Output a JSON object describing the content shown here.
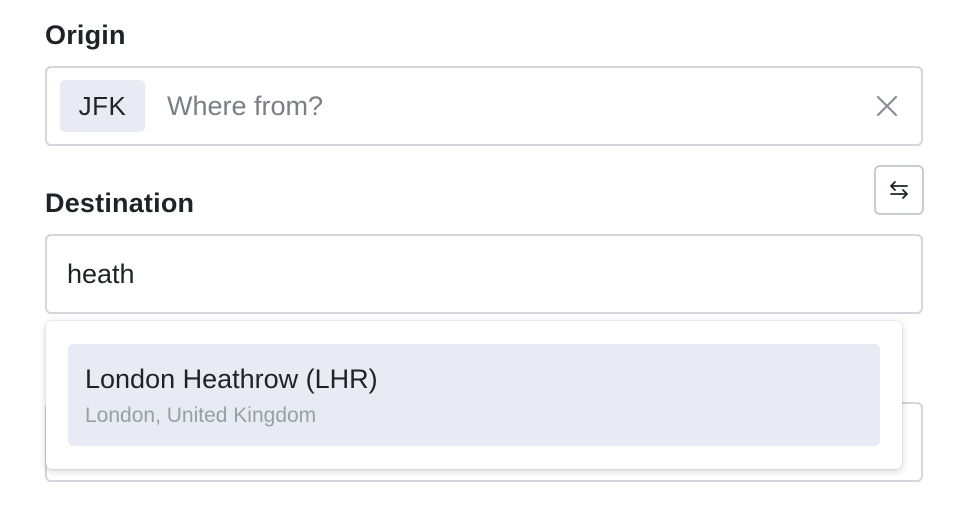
{
  "origin": {
    "label": "Origin",
    "selected_code": "JFK",
    "value": "",
    "placeholder": "Where from?",
    "clear_icon": "close-icon"
  },
  "swap": {
    "icon": "swap-arrows-icon"
  },
  "destination": {
    "label": "Destination",
    "value": "heath"
  },
  "suggestions": [
    {
      "name": "London Heathrow (LHR)",
      "location": "London, United Kingdom"
    }
  ],
  "colors": {
    "chip_bg": "#e8ebf3",
    "highlight_bg": "#e8ebf3",
    "border": "#d3d6db",
    "text": "#1f2328",
    "muted": "#9a9ea5"
  }
}
